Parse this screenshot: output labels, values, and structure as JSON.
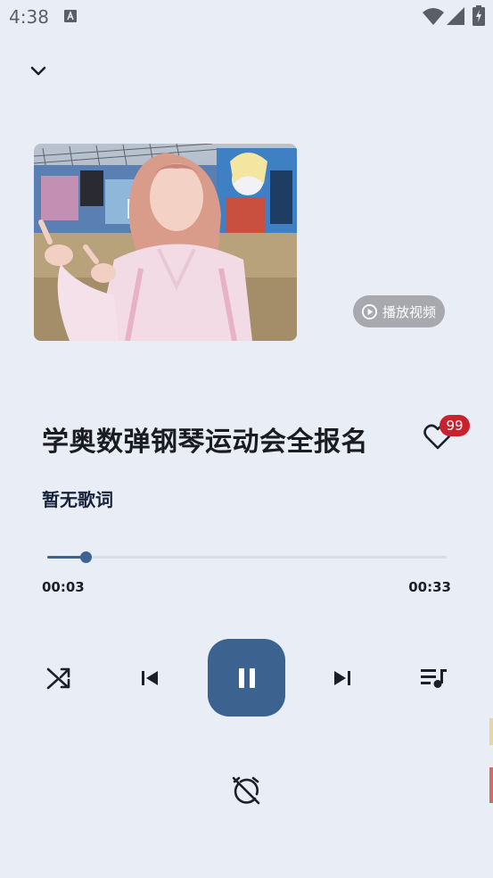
{
  "status_bar": {
    "time": "4:38"
  },
  "player": {
    "play_video_label": "播放视频",
    "title": "学奥数弹钢琴运动会全报名",
    "like_count": "99",
    "lyrics": "暂无歌词",
    "progress": {
      "elapsed": "00:03",
      "total": "00:33",
      "fraction": 0.095
    }
  },
  "colors": {
    "background": "#e9edf6",
    "accent": "#3c6290",
    "badge": "#c8232c"
  },
  "icons": [
    "chevron-down-icon",
    "play-circle-icon",
    "heart-icon",
    "shuffle-icon",
    "skip-previous-icon",
    "pause-icon",
    "skip-next-icon",
    "playlist-icon",
    "alarm-off-icon"
  ]
}
